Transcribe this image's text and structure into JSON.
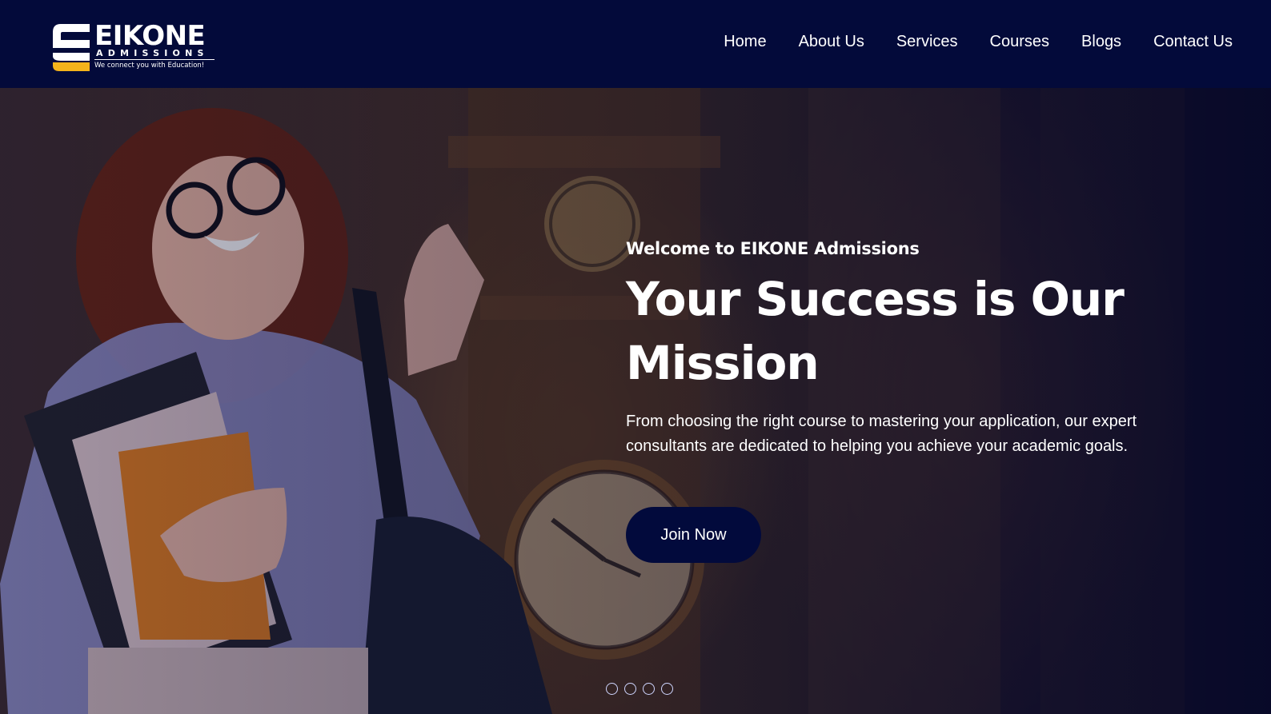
{
  "brand": {
    "name": "EIKONE",
    "sub": "ADMISSIONS",
    "tagline": "We connect you with Education!",
    "accent": "#f4b31b"
  },
  "nav": {
    "items": [
      "Home",
      "About Us",
      "Services",
      "Courses",
      "Blogs",
      "Contact Us"
    ]
  },
  "hero": {
    "eyebrow": "Welcome to EIKONE Admissions",
    "title": "Your Success is Our Mission",
    "description": "From choosing the right course to mastering your application, our expert consultants are dedicated to helping you achieve your academic goals.",
    "cta_label": "Join Now",
    "slide_count": 4
  },
  "colors": {
    "header_bg": "#030a3a",
    "button_bg": "#020a3c",
    "text": "#ffffff"
  }
}
